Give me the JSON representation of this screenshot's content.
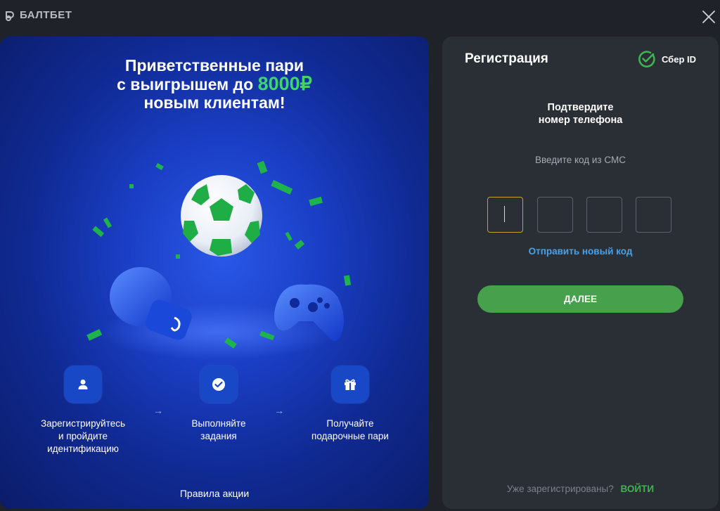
{
  "header": {
    "logo_text": "БАЛТБЕТ"
  },
  "promo": {
    "title_line1": "Приветственные пари",
    "title_line2_prefix": "с выигрышем до",
    "title_amount": "8000₽",
    "title_line3": "новым клиентам!",
    "steps": [
      {
        "icon": "user-icon",
        "line1": "Зарегистрируйтесь",
        "line2": "и пройдите",
        "line3": "идентификацию"
      },
      {
        "icon": "check-icon",
        "line1": "Выполняйте",
        "line2": "задания"
      },
      {
        "icon": "gift-icon",
        "line1": "Получайте",
        "line2": "подарочные пари"
      }
    ],
    "arrow": "→",
    "rules_link": "Правила акции"
  },
  "registration": {
    "title": "Регистрация",
    "sber_label": "Сбер ID",
    "confirm_line1": "Подтвердите",
    "confirm_line2": "номер телефона",
    "sms_hint": "Введите код из СМС",
    "code_values": [
      "",
      "",
      "",
      ""
    ],
    "resend_link": "Отправить новый код",
    "next_button": "ДАЛЕЕ",
    "already_registered": "Уже зарегистрированы?",
    "login_link": "ВОЙТИ"
  },
  "colors": {
    "accent_green": "#3ed66b",
    "button_green": "#47a04b",
    "link_blue": "#4aa1e8",
    "active_code_border": "#c9a227",
    "panel_bg": "#2a2e35",
    "page_bg": "#1f2329"
  }
}
